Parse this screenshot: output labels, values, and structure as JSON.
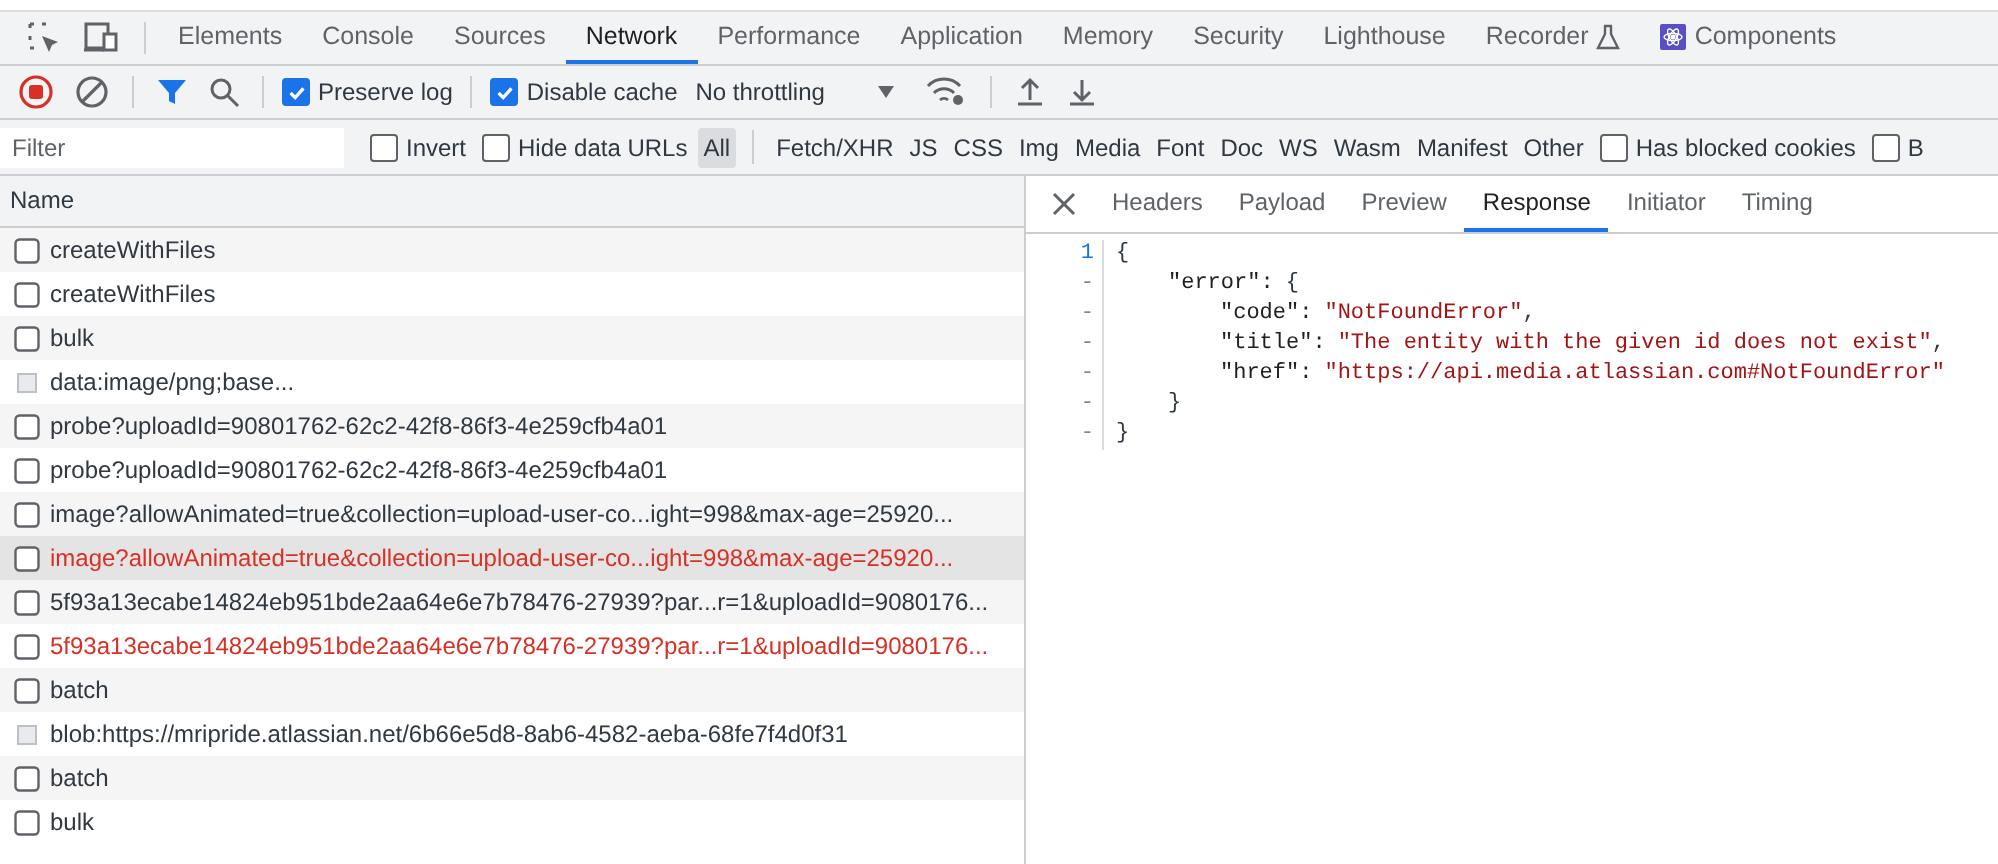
{
  "main_tabs": [
    {
      "label": "Elements",
      "selected": false
    },
    {
      "label": "Console",
      "selected": false
    },
    {
      "label": "Sources",
      "selected": false
    },
    {
      "label": "Network",
      "selected": true
    },
    {
      "label": "Performance",
      "selected": false
    },
    {
      "label": "Application",
      "selected": false
    },
    {
      "label": "Memory",
      "selected": false
    },
    {
      "label": "Security",
      "selected": false
    },
    {
      "label": "Lighthouse",
      "selected": false
    },
    {
      "label": "Recorder",
      "selected": false,
      "kind": "flask"
    },
    {
      "label": "Components",
      "selected": false,
      "kind": "react"
    }
  ],
  "toolbar": {
    "preserve_log": {
      "label": "Preserve log",
      "checked": true
    },
    "disable_cache": {
      "label": "Disable cache",
      "checked": true
    },
    "throttling": "No throttling"
  },
  "filter_bar": {
    "placeholder": "Filter",
    "options": [
      {
        "label": "Invert",
        "checked": false
      },
      {
        "label": "Hide data URLs",
        "checked": false
      }
    ],
    "types": [
      {
        "label": "All",
        "selected": true
      },
      {
        "label": "Fetch/XHR",
        "selected": false
      },
      {
        "label": "JS",
        "selected": false
      },
      {
        "label": "CSS",
        "selected": false
      },
      {
        "label": "Img",
        "selected": false
      },
      {
        "label": "Media",
        "selected": false
      },
      {
        "label": "Font",
        "selected": false
      },
      {
        "label": "Doc",
        "selected": false
      },
      {
        "label": "WS",
        "selected": false
      },
      {
        "label": "Wasm",
        "selected": false
      },
      {
        "label": "Manifest",
        "selected": false
      },
      {
        "label": "Other",
        "selected": false
      }
    ],
    "extra_options": [
      {
        "label": "Has blocked cookies",
        "checked": false
      },
      {
        "label": "B",
        "checked": false
      }
    ]
  },
  "requests": {
    "column": "Name",
    "rows": [
      {
        "name": "createWithFiles",
        "kind": "document",
        "error": false,
        "selected": false
      },
      {
        "name": "createWithFiles",
        "kind": "document",
        "error": false,
        "selected": false
      },
      {
        "name": "bulk",
        "kind": "document",
        "error": false,
        "selected": false
      },
      {
        "name": "data:image/png;base...",
        "kind": "image",
        "error": false,
        "selected": false
      },
      {
        "name": "probe?uploadId=90801762-62c2-42f8-86f3-4e259cfb4a01",
        "kind": "document",
        "error": false,
        "selected": false
      },
      {
        "name": "probe?uploadId=90801762-62c2-42f8-86f3-4e259cfb4a01",
        "kind": "document",
        "error": false,
        "selected": false
      },
      {
        "name": "image?allowAnimated=true&collection=upload-user-co...ight=998&max-age=25920...",
        "kind": "document",
        "error": false,
        "selected": false
      },
      {
        "name": "image?allowAnimated=true&collection=upload-user-co...ight=998&max-age=25920...",
        "kind": "document",
        "error": true,
        "selected": true
      },
      {
        "name": "5f93a13ecabe14824eb951bde2aa64e6e7b78476-27939?par...r=1&uploadId=9080176...",
        "kind": "document",
        "error": false,
        "selected": false
      },
      {
        "name": "5f93a13ecabe14824eb951bde2aa64e6e7b78476-27939?par...r=1&uploadId=9080176...",
        "kind": "document",
        "error": true,
        "selected": false
      },
      {
        "name": "batch",
        "kind": "document",
        "error": false,
        "selected": false
      },
      {
        "name": "blob:https://mripride.atlassian.net/6b66e5d8-8ab6-4582-aeba-68fe7f4d0f31",
        "kind": "image",
        "error": false,
        "selected": false
      },
      {
        "name": "batch",
        "kind": "document",
        "error": false,
        "selected": false
      },
      {
        "name": "bulk",
        "kind": "document",
        "error": false,
        "selected": false
      }
    ]
  },
  "detail_tabs": [
    {
      "label": "Headers",
      "selected": false
    },
    {
      "label": "Payload",
      "selected": false
    },
    {
      "label": "Preview",
      "selected": false
    },
    {
      "label": "Response",
      "selected": true
    },
    {
      "label": "Initiator",
      "selected": false
    },
    {
      "label": "Timing",
      "selected": false
    }
  ],
  "response": {
    "gutter": "1",
    "open": "{",
    "close_gutter": "-",
    "close": "}",
    "children": [
      {
        "gutter": "-",
        "key": "\"error\":",
        "open": "{",
        "close_gutter": "-",
        "close": "}",
        "children": [
          {
            "gutter": "-",
            "key": "\"code\":",
            "value": "\"NotFoundError\"",
            "comma": ","
          },
          {
            "gutter": "-",
            "key": "\"title\":",
            "value": "\"The entity with the given id does not exist\"",
            "comma": ","
          },
          {
            "gutter": "-",
            "key": "\"href\":",
            "value": "\"https://api.media.atlassian.com#NotFoundError\""
          }
        ]
      }
    ]
  }
}
